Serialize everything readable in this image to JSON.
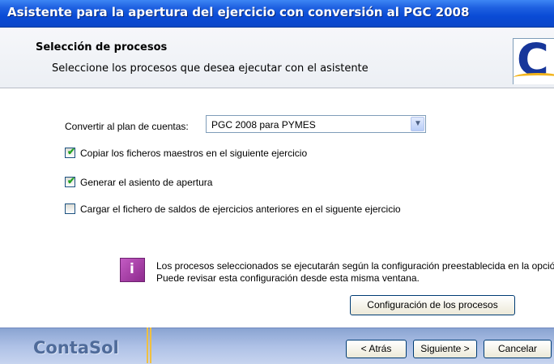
{
  "window": {
    "title": "Asistente para la apertura del ejercicio con conversión al PGC 2008"
  },
  "header": {
    "title": "Selección de procesos",
    "subtitle": "Seleccione los procesos que desea ejecutar con el asistente",
    "logo_letter": "C"
  },
  "form": {
    "plan_label": "Convertir al plan de cuentas:",
    "plan_value": "PGC 2008 para PYMES",
    "checkboxes": [
      {
        "label": "Copiar los ficheros maestros en el siguiente ejercicio",
        "checked": true
      },
      {
        "label": "Generar el asiento de apertura",
        "checked": true
      },
      {
        "label": "Cargar el fichero de saldos de ejercicios anteriores en el siguente ejercicio",
        "checked": false
      }
    ]
  },
  "info": {
    "icon": "i",
    "line1": "Los procesos seleccionados se ejecutarán según la configuración preestablecida en la opción.",
    "line2": "Puede revisar esta configuración desde esta misma ventana.",
    "config_button": "Configuración de los procesos"
  },
  "footer": {
    "brand": "ContaSol",
    "back": "< Atrás",
    "next": "Siguiente >",
    "cancel": "Cancelar"
  },
  "colors": {
    "title_bar": "#0a4bd6",
    "info_icon": "#a33ca3",
    "brand": "#4f6b9a"
  }
}
